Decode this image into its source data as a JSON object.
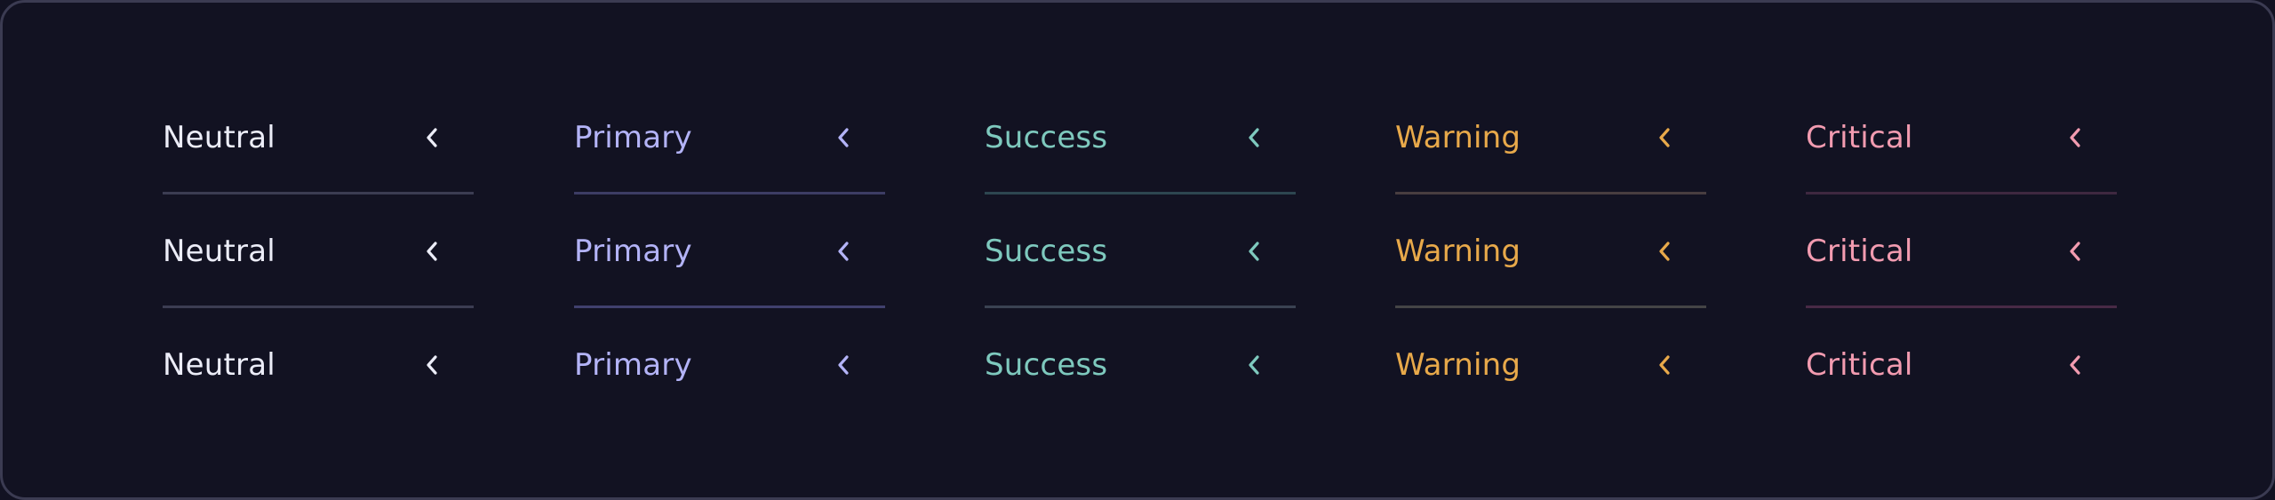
{
  "columns": [
    {
      "variant": "neutral",
      "color": "#ecedf8",
      "divider_colors": [
        "#3b3c52",
        "#3b3c52"
      ],
      "items": [
        {
          "label": "Neutral",
          "icon": "chevron-left-icon"
        },
        {
          "label": "Neutral",
          "icon": "chevron-left-icon"
        },
        {
          "label": "Neutral",
          "icon": "chevron-left-icon"
        }
      ]
    },
    {
      "variant": "primary",
      "color": "#b3b3f7",
      "divider_colors": [
        "#3c3c64",
        "#40406e"
      ],
      "items": [
        {
          "label": "Primary",
          "icon": "chevron-left-icon"
        },
        {
          "label": "Primary",
          "icon": "chevron-left-icon"
        },
        {
          "label": "Primary",
          "icon": "chevron-left-icon"
        }
      ]
    },
    {
      "variant": "success",
      "color": "#7ec9be",
      "divider_colors": [
        "#2d4650",
        "#3a4252"
      ],
      "items": [
        {
          "label": "Success",
          "icon": "chevron-left-icon"
        },
        {
          "label": "Success",
          "icon": "chevron-left-icon"
        },
        {
          "label": "Success",
          "icon": "chevron-left-icon"
        }
      ]
    },
    {
      "variant": "warning",
      "color": "#e8a94a",
      "divider_colors": [
        "#483d40",
        "#444446"
      ],
      "items": [
        {
          "label": "Warning",
          "icon": "chevron-left-icon"
        },
        {
          "label": "Warning",
          "icon": "chevron-left-icon"
        },
        {
          "label": "Warning",
          "icon": "chevron-left-icon"
        }
      ]
    },
    {
      "variant": "critical",
      "color": "#f29bb0",
      "divider_colors": [
        "#3e2840",
        "#482a46"
      ],
      "items": [
        {
          "label": "Critical",
          "icon": "chevron-left-icon"
        },
        {
          "label": "Critical",
          "icon": "chevron-left-icon"
        },
        {
          "label": "Critical",
          "icon": "chevron-left-icon"
        }
      ]
    }
  ]
}
